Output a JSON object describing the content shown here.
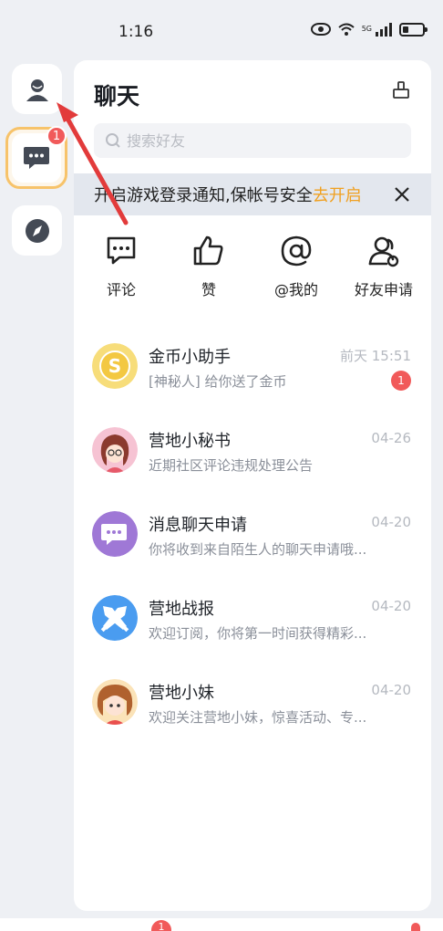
{
  "status_bar": {
    "time": "1:16",
    "network": "5G",
    "icons": [
      "eye-icon",
      "wifi-icon",
      "signal-icon",
      "battery-icon"
    ]
  },
  "rail": {
    "items": [
      {
        "name": "profile",
        "icon": "person-icon"
      },
      {
        "name": "chat",
        "icon": "chat-bubble-icon",
        "badge": "1",
        "active": true
      },
      {
        "name": "discover",
        "icon": "compass-icon"
      }
    ]
  },
  "header": {
    "title": "聊天",
    "clean_icon": "broom-icon"
  },
  "search": {
    "placeholder": "搜索好友"
  },
  "notice": {
    "text": "开启游戏登录通知,保帐号安全",
    "link": "去开启",
    "close_icon": "close-icon"
  },
  "quick_actions": [
    {
      "label": "评论",
      "icon": "comment-icon"
    },
    {
      "label": "赞",
      "icon": "thumbs-up-icon"
    },
    {
      "label": "@我的",
      "icon": "at-icon"
    },
    {
      "label": "好友申请",
      "icon": "friend-request-icon"
    }
  ],
  "conversations": [
    {
      "name": "金币小助手",
      "preview": "[神秘人] 给你送了金币",
      "time": "前天 15:51",
      "unread": "1",
      "avatar": "coin-avatar",
      "color": "#f6d56a"
    },
    {
      "name": "营地小秘书",
      "preview": "近期社区评论违规处理公告",
      "time": "04-26",
      "avatar": "secretary-avatar",
      "color": "#f3b5c8"
    },
    {
      "name": "消息聊天申请",
      "preview": "你将收到来自陌生人的聊天申请哦...",
      "time": "04-20",
      "avatar": "chat-request-avatar",
      "color": "#a07ad8"
    },
    {
      "name": "营地战报",
      "preview": "欢迎订阅，你将第一时间获得精彩...",
      "time": "04-20",
      "avatar": "battle-report-avatar",
      "color": "#4c9cf0"
    },
    {
      "name": "营地小妹",
      "preview": "欢迎关注营地小妹，惊喜活动、专...",
      "time": "04-20",
      "avatar": "girl-avatar",
      "color": "#f7c98a"
    }
  ],
  "bottom_bar": {
    "badge": "1"
  },
  "colors": {
    "accent": "#f0a020",
    "badge": "#f15a5a",
    "annotation_arrow": "#e23b3b"
  }
}
